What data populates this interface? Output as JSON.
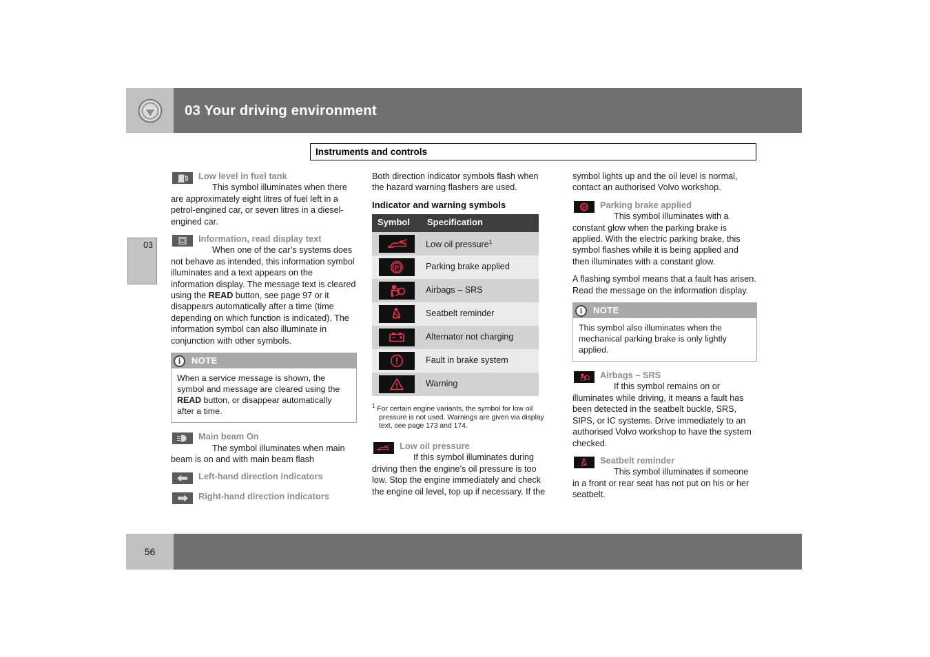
{
  "header": {
    "chapter_number": "03",
    "title": "03 Your driving environment",
    "icon": "steering-wheel-icon"
  },
  "section_title": "Instruments and controls",
  "chapter_tab": "03",
  "footer": {
    "page_number": "56"
  },
  "column1": {
    "fuel": {
      "icon": "fuel-pump-icon",
      "heading": "Low level in fuel tank",
      "body": "This symbol illuminates when there are approximately eight litres of fuel left in a petrol-engined car, or seven litres in a diesel-engined car."
    },
    "information": {
      "icon": "information-icon",
      "heading": "Information, read display text",
      "body_1": "When one of the car’s systems does not behave as intended, this information symbol illuminates and a text appears on the information display. The message text is cleared using the ",
      "bold_1": "READ",
      "body_2": " button, see page 97 or it disappears automatically after a time (time depending on which function is indicated). The information symbol can also illuminate in conjunction with other symbols."
    },
    "note": {
      "icon": "info-circle-icon",
      "title": "NOTE",
      "body_1": "When a service message is shown, the symbol and message are cleared using the ",
      "bold_1": "READ",
      "body_2": " button, or disappear automatically after a time."
    },
    "main_beam": {
      "icon": "main-beam-icon",
      "heading": "Main beam On",
      "body": "The symbol illuminates when main beam is on and with main beam flash"
    },
    "left_indicator": {
      "icon": "arrow-left-icon",
      "heading": "Left-hand direction indicators"
    },
    "right_indicator": {
      "icon": "arrow-right-icon",
      "heading": "Right-hand direction indicators"
    }
  },
  "column2": {
    "intro": "Both direction indicator symbols flash when the hazard warning flashers are used.",
    "table_title": "Indicator and warning symbols",
    "table": {
      "headers": [
        "Symbol",
        "Specification"
      ],
      "rows": [
        {
          "icon": "oil-can-icon",
          "label": "Low oil pressure",
          "footnote_marker": "1"
        },
        {
          "icon": "parking-brake-icon",
          "label": "Parking brake applied",
          "footnote_marker": ""
        },
        {
          "icon": "airbag-srs-icon",
          "label": "Airbags – SRS",
          "footnote_marker": ""
        },
        {
          "icon": "seatbelt-icon",
          "label": "Seatbelt reminder",
          "footnote_marker": ""
        },
        {
          "icon": "battery-icon",
          "label": "Alternator not charging",
          "footnote_marker": ""
        },
        {
          "icon": "brake-fault-icon",
          "label": "Fault in brake system",
          "footnote_marker": ""
        },
        {
          "icon": "warning-triangle-icon",
          "label": "Warning",
          "footnote_marker": ""
        }
      ]
    },
    "footnote": {
      "marker": "1",
      "text": "For certain engine variants, the symbol for low oil pressure is not used. Warnings are given via display text, see page 173 and 174."
    },
    "low_oil": {
      "icon": "oil-can-icon",
      "heading": "Low oil pressure",
      "body": "If this symbol illuminates during driving then the engine’s oil pressure is too low. Stop the engine immediately and check the engine oil level, top up if necessary. If the"
    }
  },
  "column3": {
    "continued": "symbol lights up and the oil level is normal, contact an authorised Volvo workshop.",
    "parking_brake": {
      "icon": "parking-brake-icon",
      "heading": "Parking brake applied",
      "body": "This symbol illuminates with a constant glow when the parking brake is applied. With the electric parking brake, this symbol flashes while it is being applied and then illuminates with a constant glow."
    },
    "flashing_para": "A flashing symbol means that a fault has arisen. Read the message on the information display.",
    "note": {
      "icon": "info-circle-icon",
      "title": "NOTE",
      "body": "This symbol also illuminates when the mechanical parking brake is only lightly applied."
    },
    "airbags": {
      "icon": "airbag-srs-icon",
      "heading": "Airbags – SRS",
      "body": "If this symbol remains on or illuminates while driving, it means a fault has been detected in the seatbelt buckle, SRS, SIPS, or IC systems. Drive immediately to an authorised Volvo workshop to have the system checked."
    },
    "seatbelt": {
      "icon": "seatbelt-icon",
      "heading": "Seatbelt reminder",
      "body": "This symbol illuminates if someone in a front or rear seat has not put on his or her seatbelt."
    }
  },
  "colors": {
    "header_bar": "#707070",
    "header_tab": "#c0c0c0",
    "table_header": "#3d3d3d",
    "row_odd": "#d2d2d2",
    "row_even": "#eaeaea",
    "icon_red": "#e8334a",
    "icon_box": "#111111",
    "note_header": "#a9a9a9",
    "heading_gray": "#8c8c8c"
  }
}
